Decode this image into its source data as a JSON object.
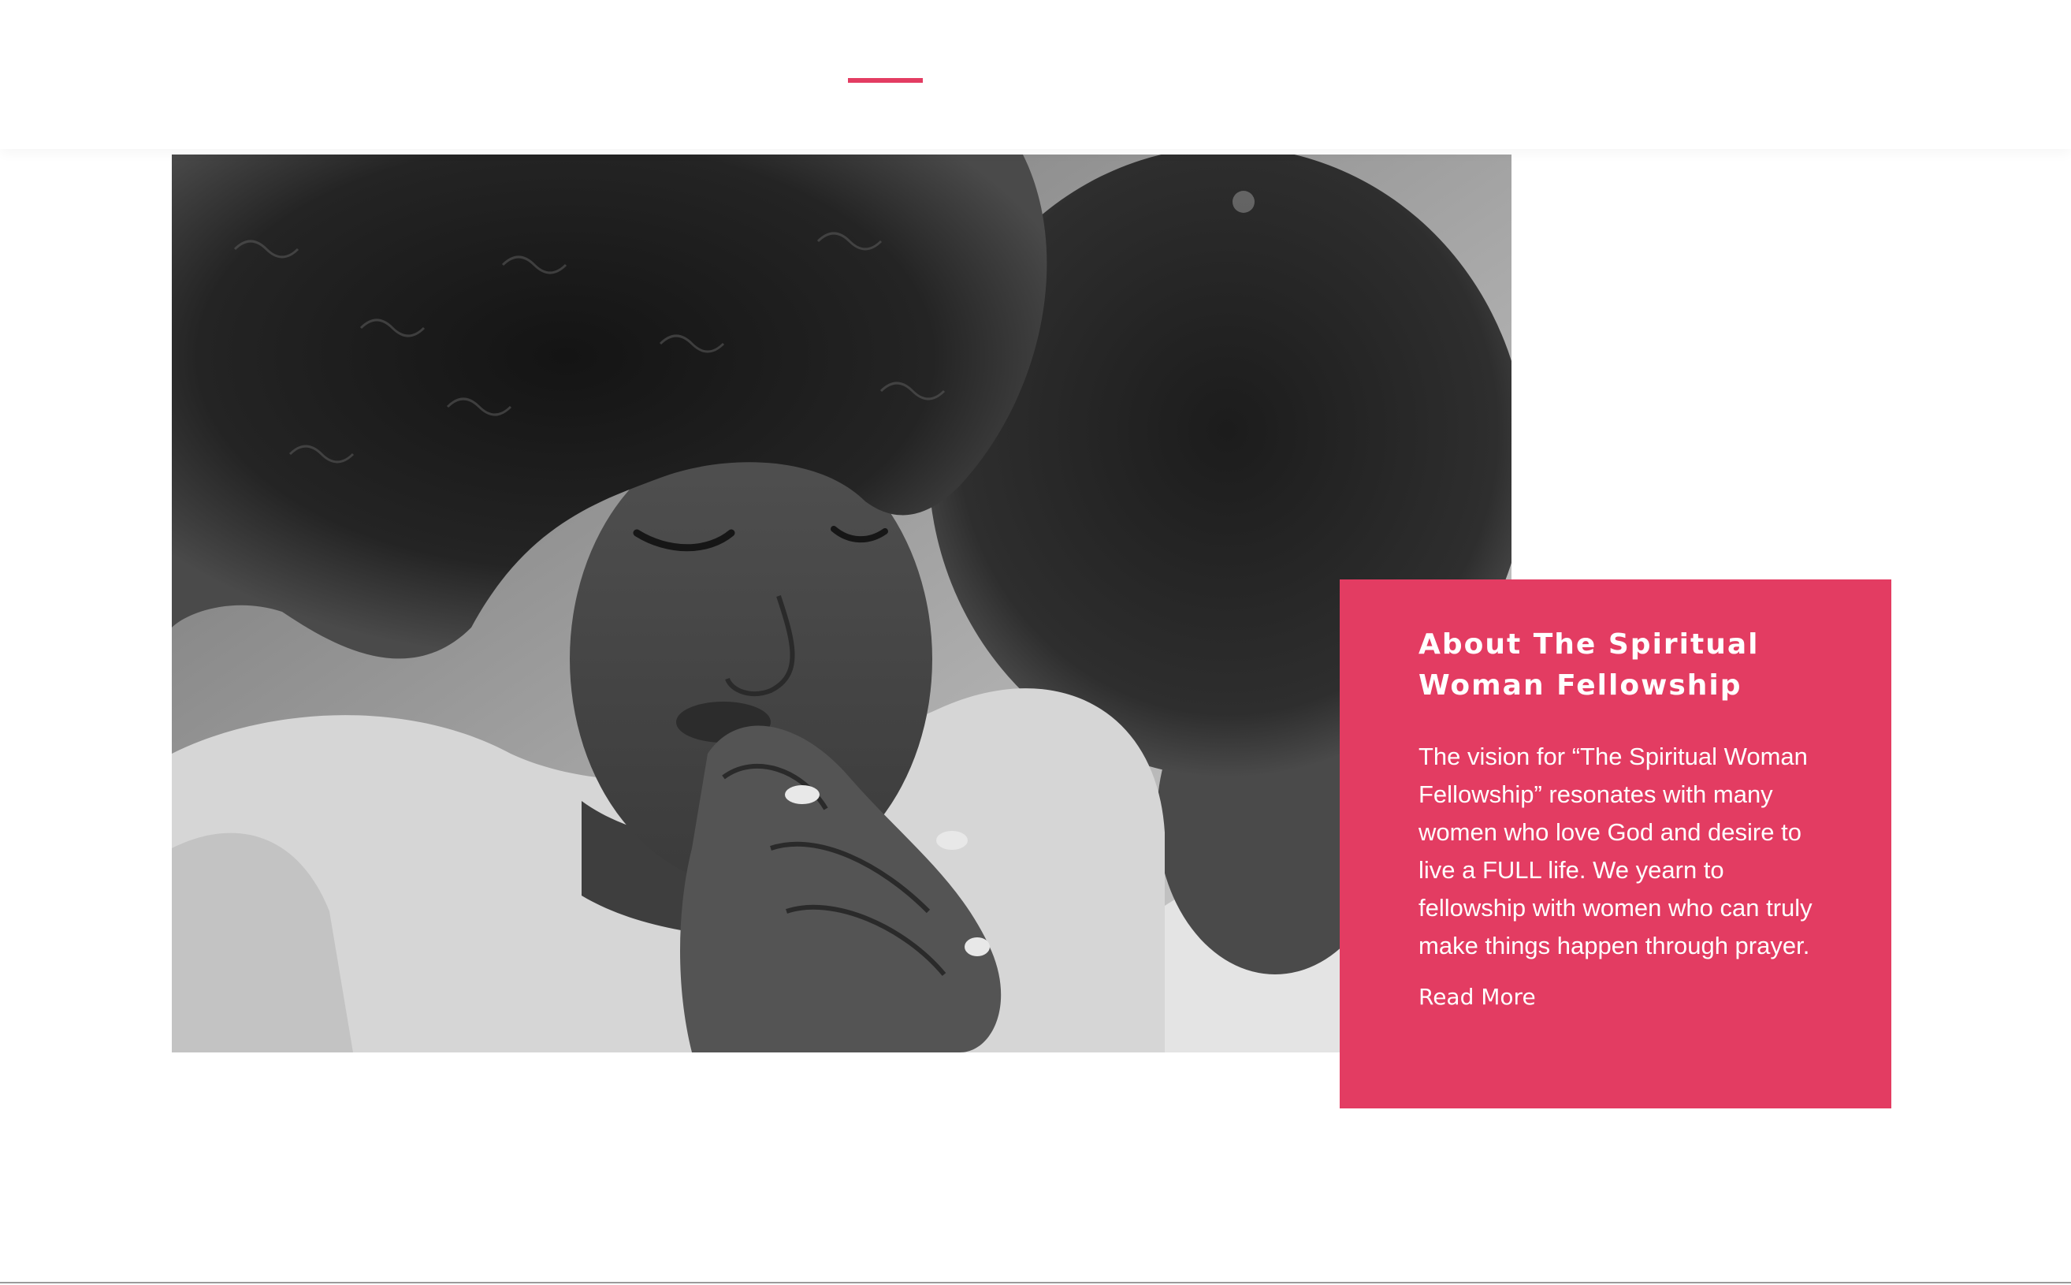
{
  "colors": {
    "accent": "#e33c62",
    "background": "#ffffff",
    "card_text": "#ffffff"
  },
  "header": {
    "accent_bar": "accent-dash"
  },
  "hero_image": {
    "icon": "photo-icon",
    "style": "black-and-white"
  },
  "about": {
    "title": "About The Spiritual Woman Fellowship",
    "body": "The vision for “The Spiritual Woman Fellowship” resonates with many women who love God and desire to live a FULL life. We yearn to fellowship with women who can truly make things happen through prayer.",
    "read_more_label": "Read More"
  }
}
